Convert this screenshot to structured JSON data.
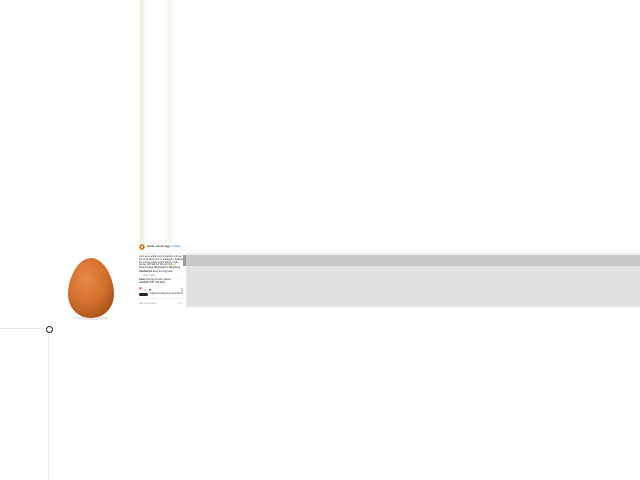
{
  "post": {
    "username": "world_record_egg",
    "follow_label": "Follow",
    "caption": "Let's set a world record together and get the most liked post on Instagram. Beating the current world record held by Kylie Jenner (18 million)! We got this 🙌 #LikeTheEgg #EggSoldiers #EggGang",
    "comments": [
      {
        "user": "xxtentacion",
        "text": "bring the egg back"
      },
      {
        "user": "travis",
        "text": "this egg is going places"
      },
      {
        "user": "user123",
        "text": "LIKE THE EGG"
      }
    ],
    "view_replies_label": "View replies",
    "liked_by": "Liked by kyliejenner and others",
    "add_comment_placeholder": "Add a comment...",
    "post_label": "Post"
  },
  "icons": {
    "like": "heart-icon",
    "comment": "comment-icon",
    "share": "share-icon",
    "save": "bookmark-icon",
    "close": "close-icon"
  },
  "colors": {
    "egg": "#d2702c",
    "like": "#ed4956",
    "link": "#3897f0",
    "scrollbar": "#c8c8c8",
    "panel_gray": "#e2e2e2"
  }
}
